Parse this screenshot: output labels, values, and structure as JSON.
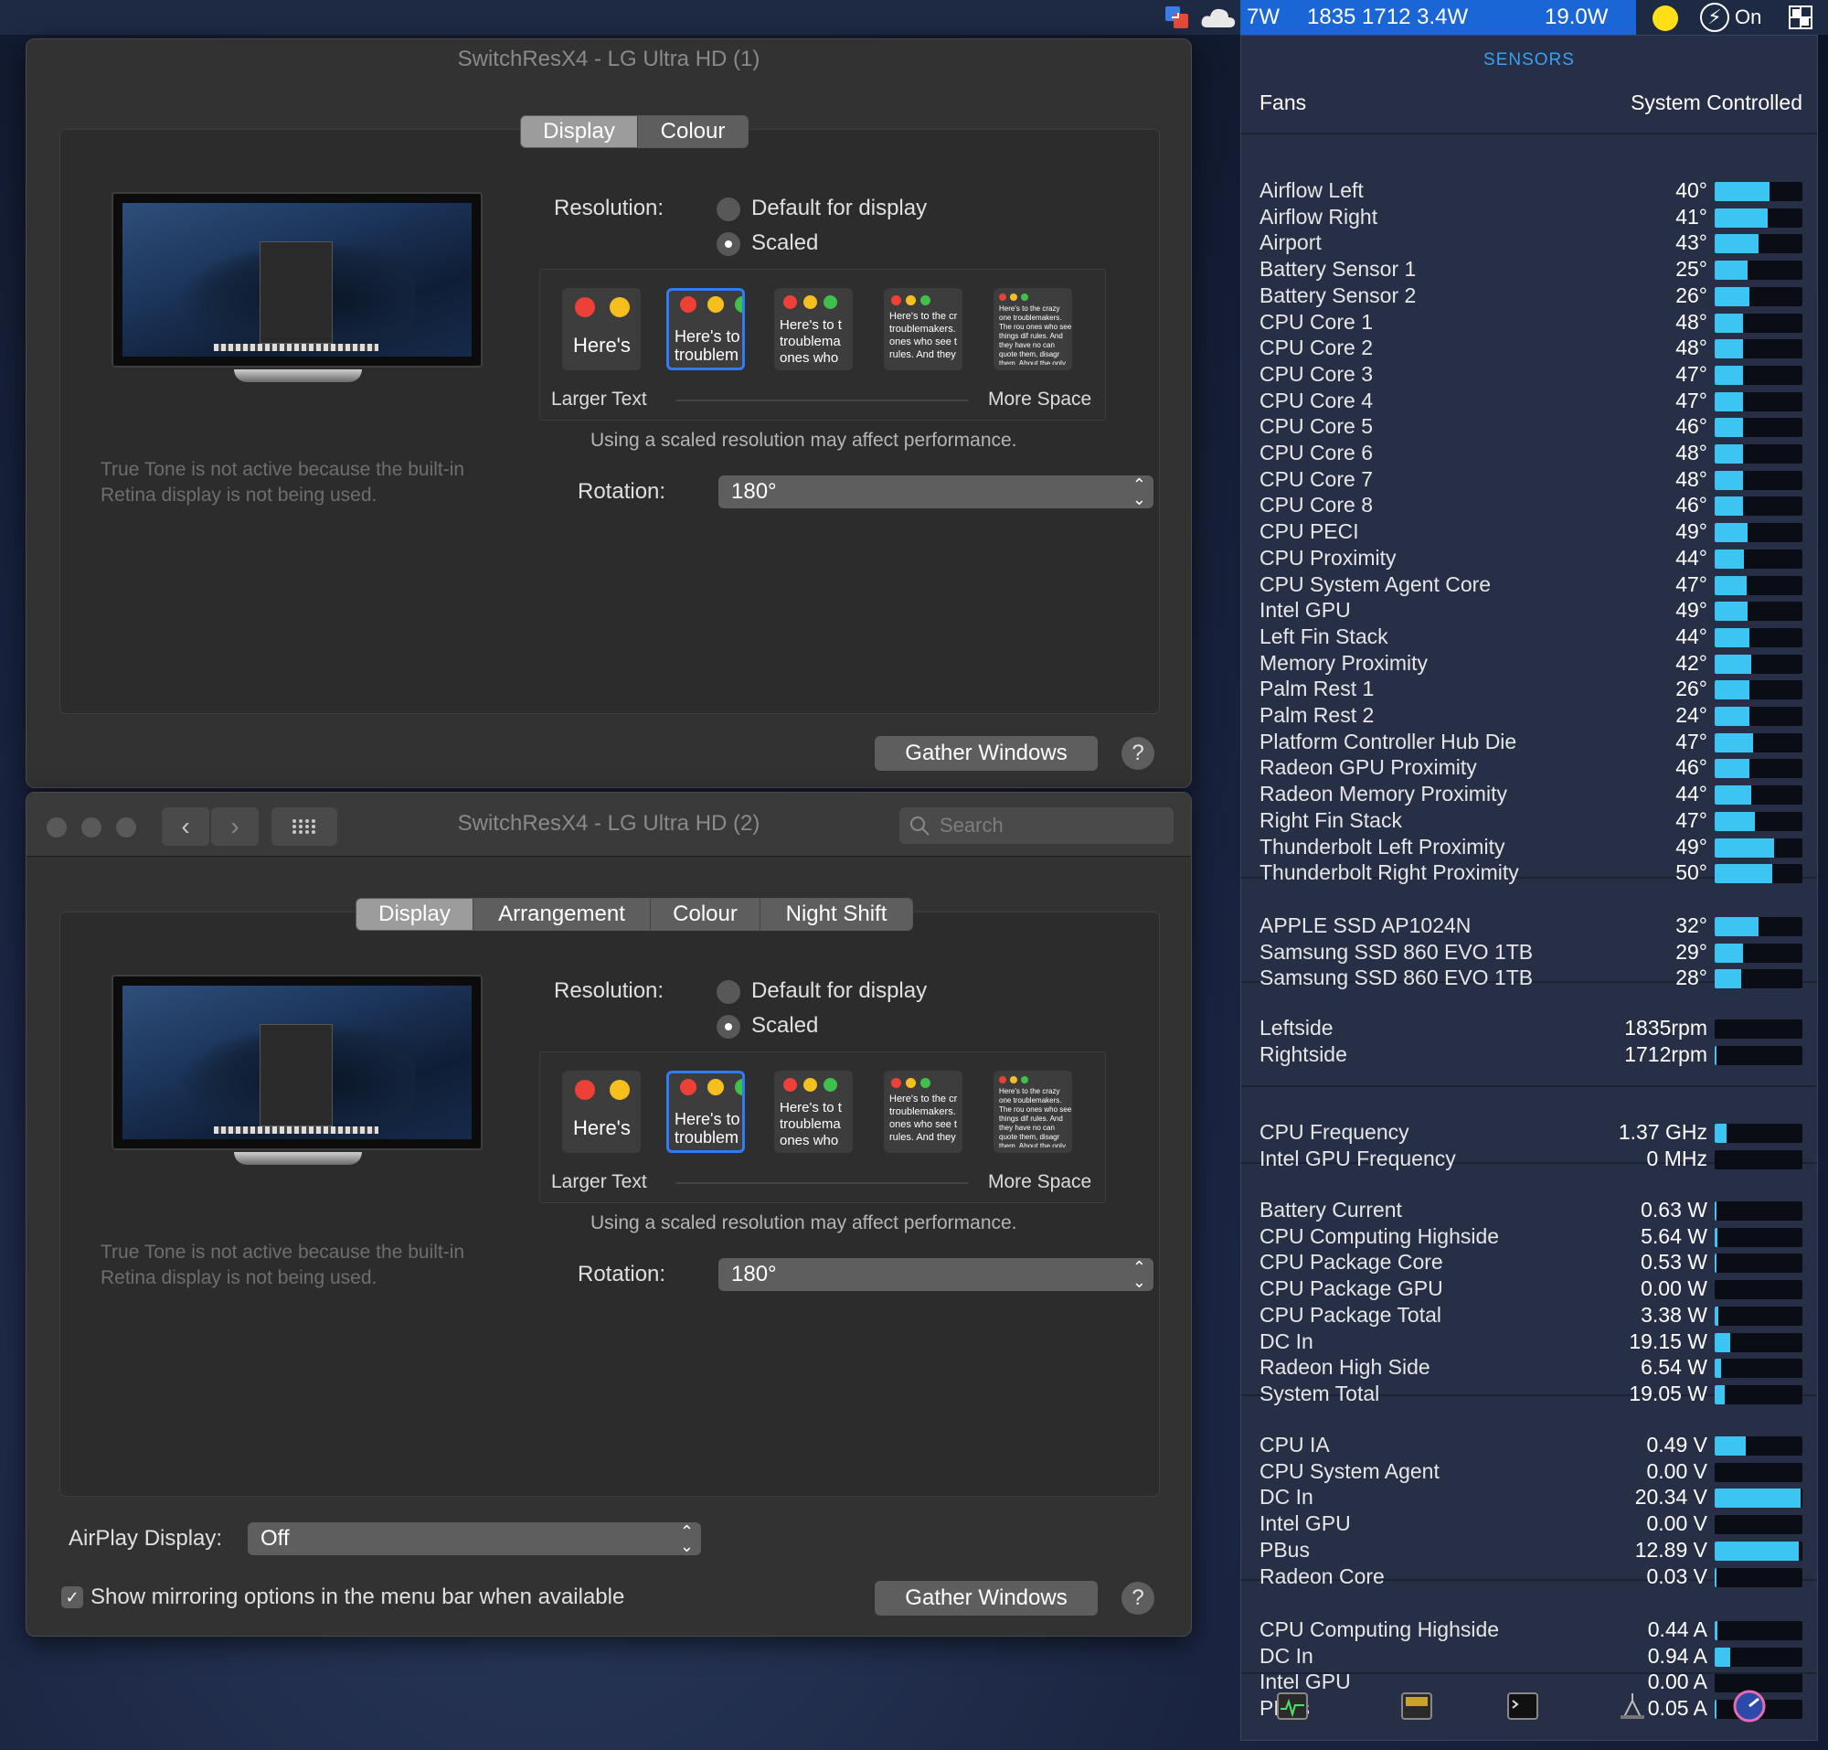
{
  "menubar": {
    "stat_fan": "7W",
    "stat_rpm": "1835 1712 3.4W",
    "stat_power": "19.0W",
    "toggle_label": "On",
    "colors": {
      "highlight": "#1a66d6",
      "sun": "#ffe018"
    },
    "icons": [
      "sync-icon",
      "cloud-icon",
      "sun-icon",
      "bolt-icon",
      "window-grid-icon"
    ]
  },
  "window1": {
    "title": "SwitchResX4 - LG Ultra HD (1)",
    "tabs": [
      "Display",
      "Colour"
    ],
    "resolution_label": "Resolution:",
    "option_default": "Default for display",
    "option_scaled": "Scaled",
    "thumb_texts": [
      "Here's",
      "Here's to troublem",
      "Here's to t troublema ones who",
      "Here's to the cr troublemakers. ones who see t rules. And they",
      "Here's to the crazy one troublemakers. The rou ones who see things dif rules. And they have no can quote them, disagr them. About the only th Because they change tl"
    ],
    "larger_text": "Larger Text",
    "more_space": "More Space",
    "perf_note": "Using a scaled resolution may affect performance.",
    "rotation_label": "Rotation:",
    "rotation_value": "180°",
    "true_tone_note": "True Tone is not active because the built-in Retina display is not being used.",
    "gather_button": "Gather Windows",
    "help": "?"
  },
  "window2": {
    "title": "SwitchResX4 - LG Ultra HD (2)",
    "search_placeholder": "Search",
    "tabs": [
      "Display",
      "Arrangement",
      "Colour",
      "Night Shift"
    ],
    "resolution_label": "Resolution:",
    "option_default": "Default for display",
    "option_scaled": "Scaled",
    "thumb_texts": [
      "Here's",
      "Here's to troublem",
      "Here's to t troublema ones who",
      "Here's to the cr troublemakers. ones who see t rules. And they",
      "Here's to the crazy one troublemakers. The rou ones who see things dif rules. And they have no can quote them, disagr them. About the only th Because they change tl"
    ],
    "larger_text": "Larger Text",
    "more_space": "More Space",
    "perf_note": "Using a scaled resolution may affect performance.",
    "rotation_label": "Rotation:",
    "rotation_value": "180°",
    "true_tone_note": "True Tone is not active because the built-in Retina display is not being used.",
    "airplay_label": "AirPlay Display:",
    "airplay_value": "Off",
    "mirroring_label": "Show mirroring options in the menu bar when available",
    "gather_button": "Gather Windows",
    "help": "?"
  },
  "sensors": {
    "header": "SENSORS",
    "fans_label": "Fans",
    "fans_mode": "System Controlled",
    "bar_color": "#3cc4f2",
    "groups": [
      {
        "rows": [
          {
            "name": "Airflow Left",
            "value": "40°",
            "level": 0.62
          },
          {
            "name": "Airflow Right",
            "value": "41°",
            "level": 0.6
          },
          {
            "name": "Airport",
            "value": "43°",
            "level": 0.5
          },
          {
            "name": "Battery Sensor 1",
            "value": "25°",
            "level": 0.37
          },
          {
            "name": "Battery Sensor 2",
            "value": "26°",
            "level": 0.4
          },
          {
            "name": "CPU Core 1",
            "value": "48°",
            "level": 0.32
          },
          {
            "name": "CPU Core 2",
            "value": "48°",
            "level": 0.32
          },
          {
            "name": "CPU Core 3",
            "value": "47°",
            "level": 0.32
          },
          {
            "name": "CPU Core 4",
            "value": "47°",
            "level": 0.32
          },
          {
            "name": "CPU Core 5",
            "value": "46°",
            "level": 0.32
          },
          {
            "name": "CPU Core 6",
            "value": "48°",
            "level": 0.32
          },
          {
            "name": "CPU Core 7",
            "value": "48°",
            "level": 0.32
          },
          {
            "name": "CPU Core 8",
            "value": "46°",
            "level": 0.32
          },
          {
            "name": "CPU PECI",
            "value": "49°",
            "level": 0.37
          },
          {
            "name": "CPU Proximity",
            "value": "44°",
            "level": 0.33
          },
          {
            "name": "CPU System Agent Core",
            "value": "47°",
            "level": 0.36
          },
          {
            "name": "Intel GPU",
            "value": "49°",
            "level": 0.37
          },
          {
            "name": "Left Fin Stack",
            "value": "44°",
            "level": 0.4
          },
          {
            "name": "Memory Proximity",
            "value": "42°",
            "level": 0.42
          },
          {
            "name": "Palm Rest 1",
            "value": "26°",
            "level": 0.4
          },
          {
            "name": "Palm Rest 2",
            "value": "24°",
            "level": 0.4
          },
          {
            "name": "Platform Controller Hub Die",
            "value": "47°",
            "level": 0.44
          },
          {
            "name": "Radeon GPU Proximity",
            "value": "46°",
            "level": 0.4
          },
          {
            "name": "Radeon Memory Proximity",
            "value": "44°",
            "level": 0.42
          },
          {
            "name": "Right Fin Stack",
            "value": "47°",
            "level": 0.46
          },
          {
            "name": "Thunderbolt Left Proximity",
            "value": "49°",
            "level": 0.68
          },
          {
            "name": "Thunderbolt Right Proximity",
            "value": "50°",
            "level": 0.66
          }
        ]
      },
      {
        "rows": [
          {
            "name": "APPLE SSD AP1024N",
            "value": "32°",
            "level": 0.5
          },
          {
            "name": "Samsung SSD 860 EVO 1TB",
            "value": "29°",
            "level": 0.32
          },
          {
            "name": "Samsung SSD 860 EVO 1TB",
            "value": "28°",
            "level": 0.3
          }
        ]
      },
      {
        "rows": [
          {
            "name": "Leftside",
            "value": "1835rpm",
            "level": 0.0
          },
          {
            "name": "Rightside",
            "value": "1712rpm",
            "level": 0.02
          }
        ]
      },
      {
        "rows": [
          {
            "name": "CPU Frequency",
            "value": "1.37 GHz",
            "level": 0.14
          },
          {
            "name": "Intel GPU Frequency",
            "value": "0 MHz",
            "level": 0.0
          }
        ]
      },
      {
        "rows": [
          {
            "name": "Battery Current",
            "value": "0.63 W",
            "level": 0.02
          },
          {
            "name": "CPU Computing Highside",
            "value": "5.64 W",
            "level": 0.03
          },
          {
            "name": "CPU Package Core",
            "value": "0.53 W",
            "level": 0.02
          },
          {
            "name": "CPU Package GPU",
            "value": "0.00 W",
            "level": 0.0
          },
          {
            "name": "CPU Package Total",
            "value": "3.38 W",
            "level": 0.04
          },
          {
            "name": "DC In",
            "value": "19.15 W",
            "level": 0.18
          },
          {
            "name": "Radeon High Side",
            "value": "6.54 W",
            "level": 0.07
          },
          {
            "name": "System Total",
            "value": "19.05 W",
            "level": 0.11
          }
        ]
      },
      {
        "rows": [
          {
            "name": "CPU IA",
            "value": "0.49 V",
            "level": 0.35
          },
          {
            "name": "CPU System Agent",
            "value": "0.00 V",
            "level": 0.0
          },
          {
            "name": "DC In",
            "value": "20.34 V",
            "level": 0.98
          },
          {
            "name": "Intel GPU",
            "value": "0.00 V",
            "level": 0.0
          },
          {
            "name": "PBus",
            "value": "12.89 V",
            "level": 0.96
          },
          {
            "name": "Radeon Core",
            "value": "0.03 V",
            "level": 0.02
          }
        ]
      },
      {
        "rows": [
          {
            "name": "CPU Computing Highside",
            "value": "0.44 A",
            "level": 0.03
          },
          {
            "name": "DC In",
            "value": "0.94 A",
            "level": 0.18
          },
          {
            "name": "Intel GPU",
            "value": "0.00 A",
            "level": 0.0
          },
          {
            "name": "PBus",
            "value": "0.05 A",
            "level": 0.02
          }
        ]
      }
    ],
    "footer_icons": [
      "activity-monitor-icon",
      "console-icon",
      "terminal-icon",
      "system-info-icon",
      "istat-menus-icon"
    ]
  }
}
